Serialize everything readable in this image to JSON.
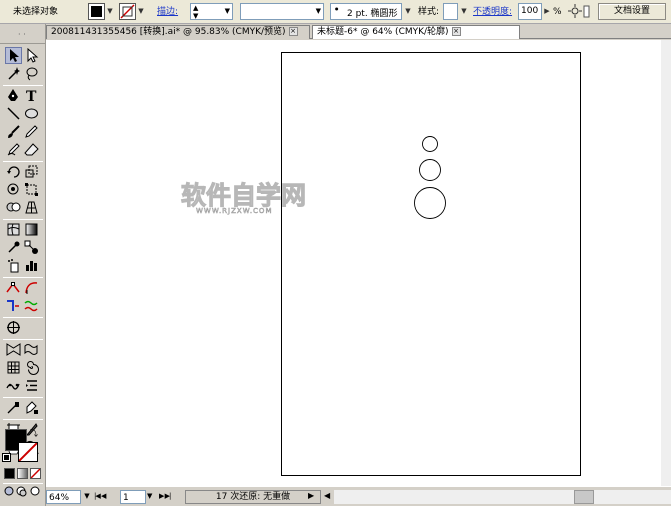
{
  "control_bar": {
    "selection_status": "未选择对象",
    "fill_color": "#000000",
    "stroke_label": "描边:",
    "stroke_weight": "",
    "brush_definition": "",
    "variable_width": "2 pt. 椭圆形",
    "style_label": "样式:",
    "opacity_label": "不透明度:",
    "opacity_value": "100",
    "opacity_unit": "%",
    "doc_setup_button": "文档设置"
  },
  "tabs": [
    {
      "label": "200811431355456 [转换].ai* @ 95.83% (CMYK/预览)",
      "active": false
    },
    {
      "label": "未标题-6* @ 64% (CMYK/轮廓)",
      "active": true
    }
  ],
  "watermark": {
    "title": "软件自学网",
    "url": "WWW.RJZXW.COM"
  },
  "status_bar": {
    "zoom": "64%",
    "artboard_number": "1",
    "undo_info": "17 次还原: 无重做"
  },
  "icons": {
    "selection": "selection-tool-icon",
    "direct_selection": "direct-selection-tool-icon",
    "pen": "pen-tool-icon",
    "type": "type-tool-icon",
    "line": "line-tool-icon",
    "ellipse": "ellipse-tool-icon"
  },
  "colors": {
    "fill_swatch": "#000000",
    "stroke_none_slash": "#cc0000",
    "link_blue": "#1a36c8"
  }
}
